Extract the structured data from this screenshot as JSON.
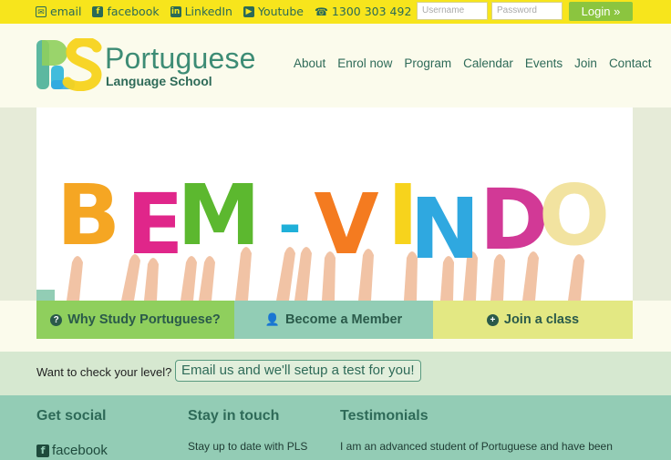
{
  "topbar": {
    "links": [
      {
        "icon": "mail-icon",
        "label": "email"
      },
      {
        "icon": "facebook-icon",
        "label": "facebook"
      },
      {
        "icon": "linkedin-icon",
        "label": "LinkedIn"
      },
      {
        "icon": "youtube-icon",
        "label": "Youtube"
      },
      {
        "icon": "phone-icon",
        "label": "1300 303 492"
      }
    ],
    "username_placeholder": "Username",
    "password_placeholder": "Password",
    "login_label": "Login »"
  },
  "header": {
    "logo_title": "Portuguese",
    "logo_sub": "Language School",
    "nav": [
      "About",
      "Enrol now",
      "Program",
      "Calendar",
      "Events",
      "Join",
      "Contact"
    ]
  },
  "hero": {
    "letters": [
      "B",
      "E",
      "M",
      "-",
      "V",
      "I",
      "N",
      "D",
      "O"
    ],
    "letter_colors": [
      "#f5a623",
      "#e0268a",
      "#5cb82f",
      "#1fb0d9",
      "#f47b20",
      "#f7d31c",
      "#2fa8e0",
      "#d23996",
      "#f2e3a0"
    ]
  },
  "features": [
    {
      "icon": "question-circle-icon",
      "label": "Why Study Portuguese?"
    },
    {
      "icon": "user-icon",
      "label": "Become a Member"
    },
    {
      "icon": "plus-circle-icon",
      "label": "Join a class"
    }
  ],
  "level": {
    "text": "Want to check your level?",
    "button": "Email us and we'll setup a test for you!"
  },
  "footer": {
    "social_heading": "Get social",
    "social_link": "facebook",
    "touch_heading": "Stay in touch",
    "touch_text": "Stay up to date with PLS",
    "testimonials_heading": "Testimonials",
    "testimonial_text": "I am an advanced student of Portuguese and have been"
  },
  "colors": {
    "topbar": "#f7e51c",
    "brand": "#3d8c75",
    "login": "#8bc53f",
    "feature1": "#8fcf5d",
    "feature2": "#92cdb5",
    "feature3": "#e3e883",
    "footer": "#93ccb5"
  }
}
